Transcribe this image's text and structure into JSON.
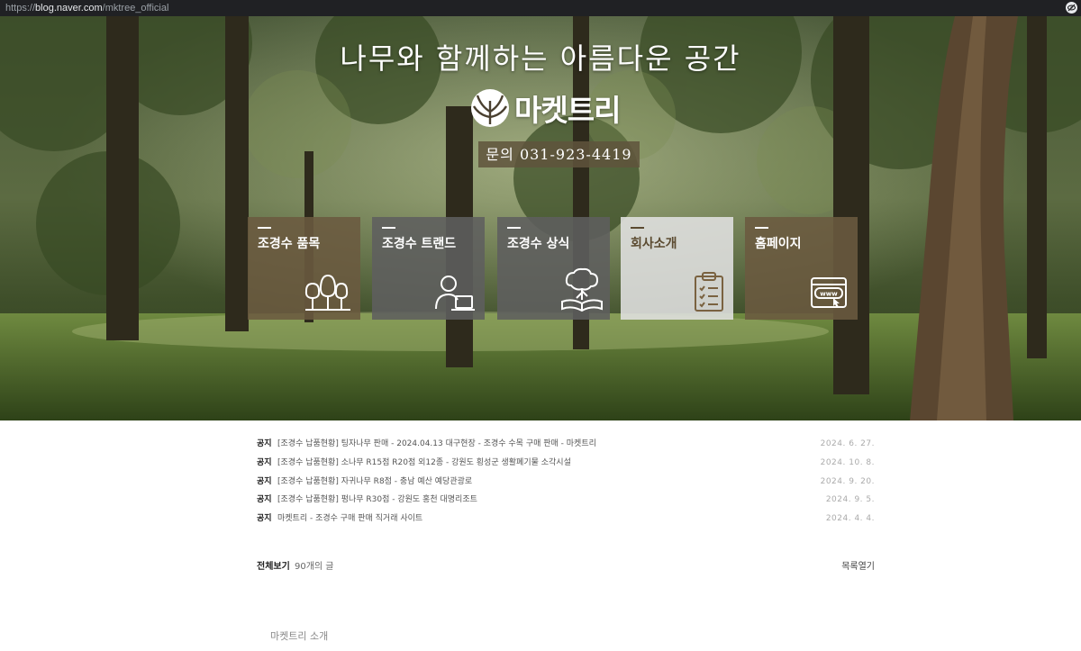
{
  "browser": {
    "url_prefix": "https://",
    "url_host": "blog.naver.com",
    "url_path": "/mktree_official",
    "icons": {
      "privacy": "eye-slash-icon"
    }
  },
  "hero": {
    "slogan": "나무와 함께하는 아름다운 공간",
    "brand_name": "마켓트리",
    "contact": "문의  031-923-4419",
    "tiles": [
      {
        "label": "조경수 품목",
        "icon": "trees-icon",
        "color": "#6b5a40"
      },
      {
        "label": "조경수 트랜드",
        "icon": "person-laptop-icon",
        "color": "#5e5e5e"
      },
      {
        "label": "조경수 상식",
        "icon": "tree-book-icon",
        "color": "#5e5e5e"
      },
      {
        "label": "회사소개",
        "icon": "clipboard-icon",
        "color": "#d8d8d8"
      },
      {
        "label": "홈페이지",
        "icon": "www-browser-icon",
        "color": "#6b5a40"
      }
    ]
  },
  "notices": [
    {
      "tag": "공지",
      "title": "[조경수 납품현황] 팅자나무 판매 - 2024.04.13 대구현장 - 조경수 수목 구매 판매 - 마켓트리",
      "date": "2024. 6. 27."
    },
    {
      "tag": "공지",
      "title": "[조경수 납품현황] 소나무 R15점 R20점 외12종 - 강원도 횡성군 생활폐기물 소각시설",
      "date": "2024. 10. 8."
    },
    {
      "tag": "공지",
      "title": "[조경수 납품현황] 자귀나무 R8점 - 충남 예산 예당관광로",
      "date": "2024. 9. 20."
    },
    {
      "tag": "공지",
      "title": "[조경수 납품현황] 펑나무 R30점 - 강원도 홍천 대명리조트",
      "date": "2024. 9. 5."
    },
    {
      "tag": "공지",
      "title": "마켓트리 - 조경수 구매 판매 직거래 사이트",
      "date": "2024. 4. 4."
    }
  ],
  "summary": {
    "all_label": "전체보기",
    "count": "90개의 글",
    "toggle": "목록열기"
  },
  "footer": {
    "intro": "마켓트리 소개"
  }
}
